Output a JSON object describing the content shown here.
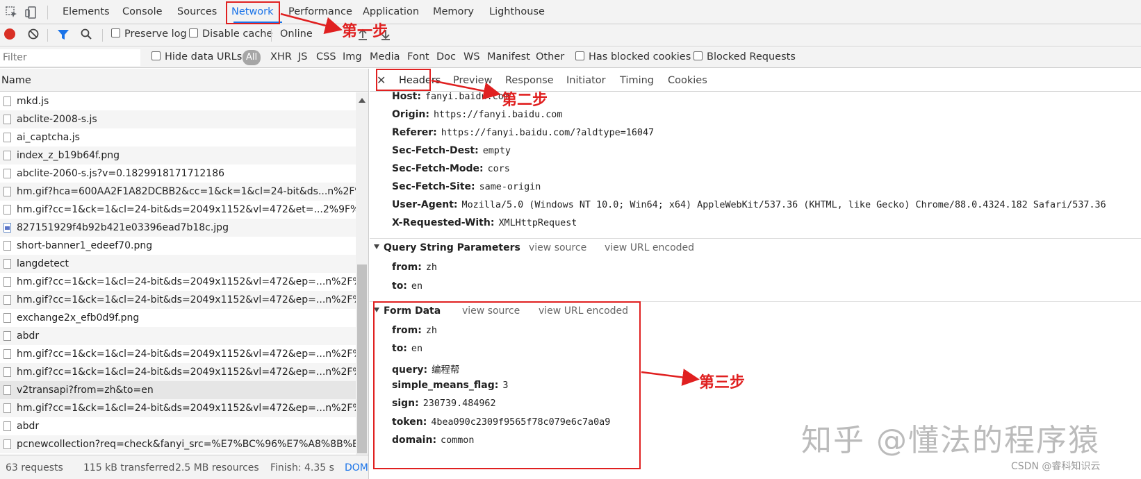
{
  "tabs": [
    "Elements",
    "Console",
    "Sources",
    "Network",
    "Performance",
    "Application",
    "Memory",
    "Lighthouse"
  ],
  "toolbar": {
    "preserve_log": "Preserve log",
    "disable_cache": "Disable cache",
    "throttle": "Online"
  },
  "filter": {
    "placeholder": "Filter",
    "hide_data_urls": "Hide data URLs",
    "all": "All",
    "types": [
      "XHR",
      "JS",
      "CSS",
      "Img",
      "Media",
      "Font",
      "Doc",
      "WS",
      "Manifest",
      "Other"
    ],
    "blocked_cookies": "Has blocked cookies",
    "blocked_requests": "Blocked Requests"
  },
  "requests": {
    "column": "Name",
    "items": [
      {
        "name": "mkd.js",
        "type": "doc"
      },
      {
        "name": "abclite-2008-s.js",
        "type": "doc"
      },
      {
        "name": "ai_captcha.js",
        "type": "doc"
      },
      {
        "name": "index_z_b19b64f.png",
        "type": "doc"
      },
      {
        "name": "abclite-2060-s.js?v=0.1829918171712186",
        "type": "doc"
      },
      {
        "name": "hm.gif?hca=600AA2F1A82DCBB2&cc=1&ck=1&cl=24-bit&ds...n%2F%25",
        "type": "doc"
      },
      {
        "name": "hm.gif?cc=1&ck=1&cl=24-bit&ds=2049x1152&vl=472&et=...2%9F%E9%",
        "type": "doc"
      },
      {
        "name": "827151929f4b92b421e03396ead7b18c.jpg",
        "type": "img"
      },
      {
        "name": "short-banner1_edeef70.png",
        "type": "doc"
      },
      {
        "name": "langdetect",
        "type": "doc"
      },
      {
        "name": "hm.gif?cc=1&ck=1&cl=24-bit&ds=2049x1152&vl=472&ep=...n%2F%25E",
        "type": "doc"
      },
      {
        "name": "hm.gif?cc=1&ck=1&cl=24-bit&ds=2049x1152&vl=472&ep=...n%2F%25E",
        "type": "doc"
      },
      {
        "name": "exchange2x_efb0d9f.png",
        "type": "doc"
      },
      {
        "name": "abdr",
        "type": "doc"
      },
      {
        "name": "hm.gif?cc=1&ck=1&cl=24-bit&ds=2049x1152&vl=472&ep=...n%2F%25E",
        "type": "doc"
      },
      {
        "name": "hm.gif?cc=1&ck=1&cl=24-bit&ds=2049x1152&vl=472&ep=...n%2F%25E",
        "type": "doc"
      },
      {
        "name": "v2transapi?from=zh&to=en",
        "type": "doc",
        "selected": true
      },
      {
        "name": "hm.gif?cc=1&ck=1&cl=24-bit&ds=2049x1152&vl=472&ep=...n%2F%25E",
        "type": "doc"
      },
      {
        "name": "abdr",
        "type": "doc"
      },
      {
        "name": "pcnewcollection?req=check&fanyi_src=%E7%BC%96%E7%A8%8B%E5%B8%AE&direct",
        "type": "doc"
      }
    ]
  },
  "status": {
    "requests": "63 requests",
    "transferred": "115 kB transferred",
    "resources": "2.5 MB resources",
    "finish": "Finish: 4.35 s",
    "dom": "DOM"
  },
  "detail_tabs": [
    "Headers",
    "Preview",
    "Response",
    "Initiator",
    "Timing",
    "Cookies"
  ],
  "request_headers": [
    {
      "key": "Host:",
      "value": "fanyi.baidu.com"
    },
    {
      "key": "Origin:",
      "value": "https://fanyi.baidu.com"
    },
    {
      "key": "Referer:",
      "value": "https://fanyi.baidu.com/?aldtype=16047"
    },
    {
      "key": "Sec-Fetch-Dest:",
      "value": "empty"
    },
    {
      "key": "Sec-Fetch-Mode:",
      "value": "cors"
    },
    {
      "key": "Sec-Fetch-Site:",
      "value": "same-origin"
    },
    {
      "key": "User-Agent:",
      "value": "Mozilla/5.0 (Windows NT 10.0; Win64; x64) AppleWebKit/537.36 (KHTML, like Gecko) Chrome/88.0.4324.182 Safari/537.36"
    },
    {
      "key": "X-Requested-With:",
      "value": "XMLHttpRequest"
    }
  ],
  "query_section": {
    "title": "Query String Parameters",
    "view_source": "view source",
    "view_url": "view URL encoded",
    "params": [
      {
        "key": "from:",
        "value": "zh"
      },
      {
        "key": "to:",
        "value": "en"
      }
    ]
  },
  "form_section": {
    "title": "Form Data",
    "view_source": "view source",
    "view_url": "view URL encoded",
    "params": [
      {
        "key": "from:",
        "value": "zh"
      },
      {
        "key": "to:",
        "value": "en"
      },
      {
        "key": "query:",
        "value": "编程帮"
      },
      {
        "key": "simple_means_flag:",
        "value": "3"
      },
      {
        "key": "sign:",
        "value": "230739.484962"
      },
      {
        "key": "token:",
        "value": "4bea090c2309f9565f78c079e6c7a0a9"
      },
      {
        "key": "domain:",
        "value": "common"
      }
    ]
  },
  "annotations": {
    "step1": "第一步",
    "step2": "第二步",
    "step3": "第三步",
    "color": "#e02020"
  },
  "watermark": "知乎 @懂法的程序猿",
  "csdn": "CSDN @睿科知识云"
}
